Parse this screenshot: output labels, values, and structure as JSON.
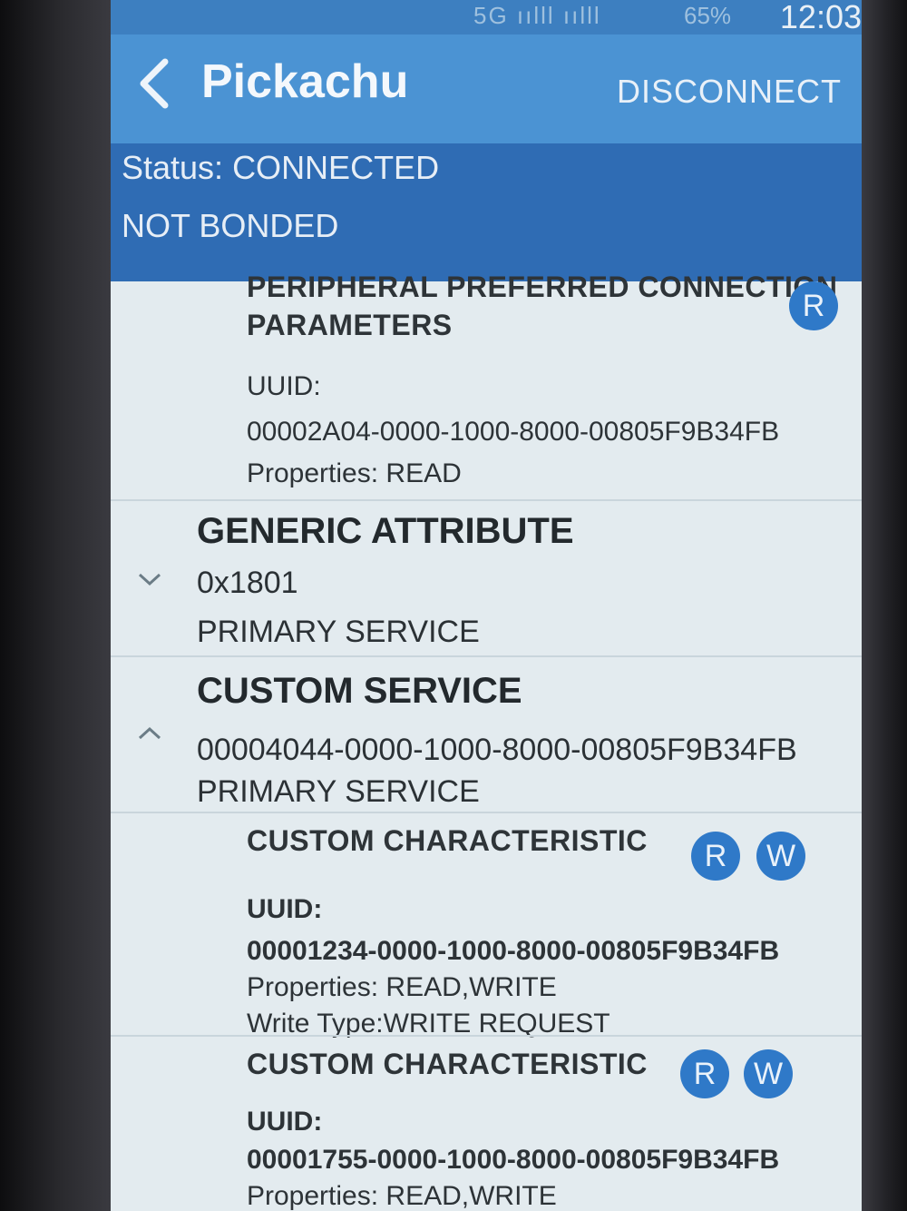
{
  "statusbar": {
    "time": "12:03",
    "battery": "65%",
    "icons": "5G ıılll ıılll"
  },
  "appbar": {
    "back_icon": "chevron-left-icon",
    "title": "Pickachu",
    "action": "DISCONNECT"
  },
  "connection": {
    "status": "Status: CONNECTED",
    "bond": "NOT BONDED"
  },
  "top_characteristic": {
    "name_line1": "PERIPHERAL PREFERRED CONNECTION",
    "name_line2": "PARAMETERS",
    "uuid_label": "UUID:",
    "uuid": "00002A04-0000-1000-8000-00805F9B34FB",
    "properties": "Properties: READ",
    "badge_r": "R"
  },
  "generic_service": {
    "name": "GENERIC ATTRIBUTE",
    "uuid": "0x1801",
    "type": "PRIMARY SERVICE",
    "chevron_icon": "chevron-down-icon"
  },
  "custom_service": {
    "name": "CUSTOM SERVICE",
    "uuid": "00004044-0000-1000-8000-00805F9B34FB",
    "type": "PRIMARY SERVICE",
    "chevron_icon": "chevron-up-icon"
  },
  "characteristics": [
    {
      "name": "CUSTOM CHARACTERISTIC",
      "uuid_label": "UUID:",
      "uuid": "00001234-0000-1000-8000-00805F9B34FB",
      "properties": "Properties: READ,WRITE",
      "write_type": "Write Type:WRITE REQUEST",
      "badge_r": "R",
      "badge_w": "W"
    },
    {
      "name": "CUSTOM CHARACTERISTIC",
      "uuid_label": "UUID:",
      "uuid": "00001755-0000-1000-8000-00805F9B34FB",
      "properties": "Properties: READ,WRITE",
      "badge_r": "R",
      "badge_w": "W"
    }
  ],
  "colors": {
    "appbar": "#4b93d3",
    "status_panel": "#2f6cb4",
    "badge": "#2f79c8",
    "background": "#e3ebef"
  }
}
